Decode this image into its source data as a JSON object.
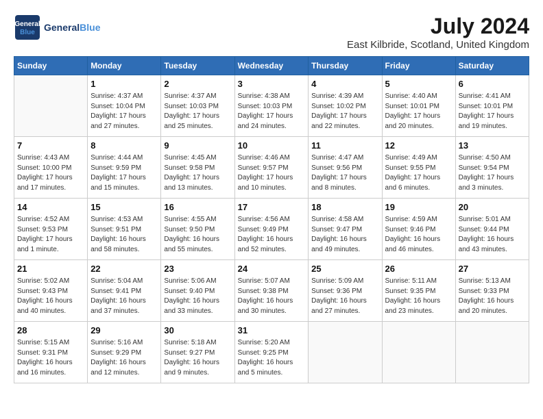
{
  "header": {
    "logo_line1": "General",
    "logo_line2": "Blue",
    "month_year": "July 2024",
    "location": "East Kilbride, Scotland, United Kingdom"
  },
  "weekdays": [
    "Sunday",
    "Monday",
    "Tuesday",
    "Wednesday",
    "Thursday",
    "Friday",
    "Saturday"
  ],
  "weeks": [
    [
      {
        "day": "",
        "info": ""
      },
      {
        "day": "1",
        "info": "Sunrise: 4:37 AM\nSunset: 10:04 PM\nDaylight: 17 hours\nand 27 minutes."
      },
      {
        "day": "2",
        "info": "Sunrise: 4:37 AM\nSunset: 10:03 PM\nDaylight: 17 hours\nand 25 minutes."
      },
      {
        "day": "3",
        "info": "Sunrise: 4:38 AM\nSunset: 10:03 PM\nDaylight: 17 hours\nand 24 minutes."
      },
      {
        "day": "4",
        "info": "Sunrise: 4:39 AM\nSunset: 10:02 PM\nDaylight: 17 hours\nand 22 minutes."
      },
      {
        "day": "5",
        "info": "Sunrise: 4:40 AM\nSunset: 10:01 PM\nDaylight: 17 hours\nand 20 minutes."
      },
      {
        "day": "6",
        "info": "Sunrise: 4:41 AM\nSunset: 10:01 PM\nDaylight: 17 hours\nand 19 minutes."
      }
    ],
    [
      {
        "day": "7",
        "info": "Sunrise: 4:43 AM\nSunset: 10:00 PM\nDaylight: 17 hours\nand 17 minutes."
      },
      {
        "day": "8",
        "info": "Sunrise: 4:44 AM\nSunset: 9:59 PM\nDaylight: 17 hours\nand 15 minutes."
      },
      {
        "day": "9",
        "info": "Sunrise: 4:45 AM\nSunset: 9:58 PM\nDaylight: 17 hours\nand 13 minutes."
      },
      {
        "day": "10",
        "info": "Sunrise: 4:46 AM\nSunset: 9:57 PM\nDaylight: 17 hours\nand 10 minutes."
      },
      {
        "day": "11",
        "info": "Sunrise: 4:47 AM\nSunset: 9:56 PM\nDaylight: 17 hours\nand 8 minutes."
      },
      {
        "day": "12",
        "info": "Sunrise: 4:49 AM\nSunset: 9:55 PM\nDaylight: 17 hours\nand 6 minutes."
      },
      {
        "day": "13",
        "info": "Sunrise: 4:50 AM\nSunset: 9:54 PM\nDaylight: 17 hours\nand 3 minutes."
      }
    ],
    [
      {
        "day": "14",
        "info": "Sunrise: 4:52 AM\nSunset: 9:53 PM\nDaylight: 17 hours\nand 1 minute."
      },
      {
        "day": "15",
        "info": "Sunrise: 4:53 AM\nSunset: 9:51 PM\nDaylight: 16 hours\nand 58 minutes."
      },
      {
        "day": "16",
        "info": "Sunrise: 4:55 AM\nSunset: 9:50 PM\nDaylight: 16 hours\nand 55 minutes."
      },
      {
        "day": "17",
        "info": "Sunrise: 4:56 AM\nSunset: 9:49 PM\nDaylight: 16 hours\nand 52 minutes."
      },
      {
        "day": "18",
        "info": "Sunrise: 4:58 AM\nSunset: 9:47 PM\nDaylight: 16 hours\nand 49 minutes."
      },
      {
        "day": "19",
        "info": "Sunrise: 4:59 AM\nSunset: 9:46 PM\nDaylight: 16 hours\nand 46 minutes."
      },
      {
        "day": "20",
        "info": "Sunrise: 5:01 AM\nSunset: 9:44 PM\nDaylight: 16 hours\nand 43 minutes."
      }
    ],
    [
      {
        "day": "21",
        "info": "Sunrise: 5:02 AM\nSunset: 9:43 PM\nDaylight: 16 hours\nand 40 minutes."
      },
      {
        "day": "22",
        "info": "Sunrise: 5:04 AM\nSunset: 9:41 PM\nDaylight: 16 hours\nand 37 minutes."
      },
      {
        "day": "23",
        "info": "Sunrise: 5:06 AM\nSunset: 9:40 PM\nDaylight: 16 hours\nand 33 minutes."
      },
      {
        "day": "24",
        "info": "Sunrise: 5:07 AM\nSunset: 9:38 PM\nDaylight: 16 hours\nand 30 minutes."
      },
      {
        "day": "25",
        "info": "Sunrise: 5:09 AM\nSunset: 9:36 PM\nDaylight: 16 hours\nand 27 minutes."
      },
      {
        "day": "26",
        "info": "Sunrise: 5:11 AM\nSunset: 9:35 PM\nDaylight: 16 hours\nand 23 minutes."
      },
      {
        "day": "27",
        "info": "Sunrise: 5:13 AM\nSunset: 9:33 PM\nDaylight: 16 hours\nand 20 minutes."
      }
    ],
    [
      {
        "day": "28",
        "info": "Sunrise: 5:15 AM\nSunset: 9:31 PM\nDaylight: 16 hours\nand 16 minutes."
      },
      {
        "day": "29",
        "info": "Sunrise: 5:16 AM\nSunset: 9:29 PM\nDaylight: 16 hours\nand 12 minutes."
      },
      {
        "day": "30",
        "info": "Sunrise: 5:18 AM\nSunset: 9:27 PM\nDaylight: 16 hours\nand 9 minutes."
      },
      {
        "day": "31",
        "info": "Sunrise: 5:20 AM\nSunset: 9:25 PM\nDaylight: 16 hours\nand 5 minutes."
      },
      {
        "day": "",
        "info": ""
      },
      {
        "day": "",
        "info": ""
      },
      {
        "day": "",
        "info": ""
      }
    ]
  ]
}
